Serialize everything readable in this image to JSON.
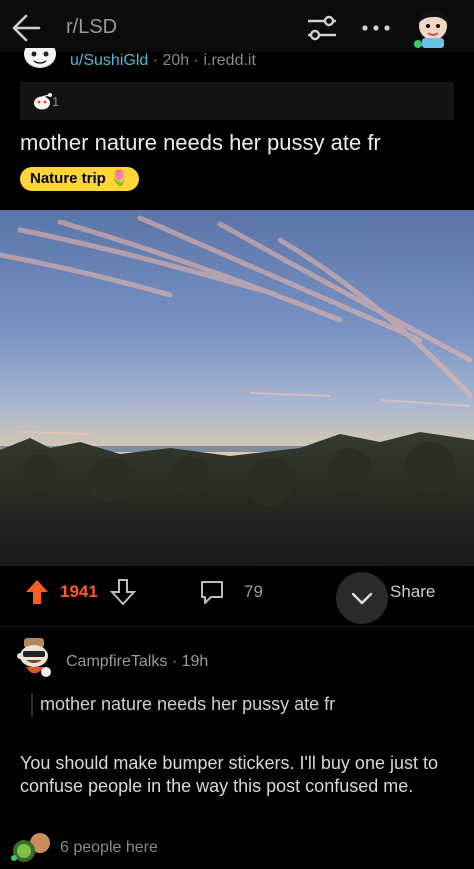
{
  "header": {
    "subreddit": "r/LSD",
    "icons": [
      "back-arrow-icon",
      "filter-icon",
      "more-dots-icon",
      "user-avatar-icon"
    ]
  },
  "post": {
    "author": "u/SushiGld",
    "age": "20h",
    "domain": "i.redd.it",
    "award_count": "1",
    "title": "mother nature needs her pussy ate fr",
    "flair": "Nature trip 🌷",
    "votes": "1941",
    "comments": "79",
    "share_label": "Share"
  },
  "comment": {
    "author": "CampfireTalks",
    "age": "19h",
    "quote": "mother nature needs her pussy ate fr",
    "body": "You should make bumper stickers. I'll buy one just to confuse people in the way this post confused me."
  },
  "presence": {
    "text": "6 people here"
  },
  "colors": {
    "background": "#000000",
    "accent_upvote": "#ff5a1f",
    "username": "#4fbcd3",
    "flair_bg": "#ffd635"
  }
}
